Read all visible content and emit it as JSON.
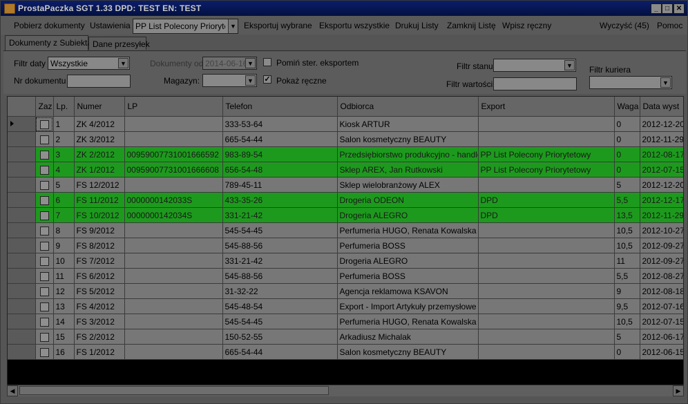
{
  "window": {
    "title": "ProstaPaczka SGT 1.33 DPD: TEST EN: TEST",
    "minimize": "_",
    "maximize": "□",
    "close": "✕"
  },
  "menu": {
    "fetch": "Pobierz dokumenty",
    "settings": "Ustawienia",
    "print_type": "PP List Polecony Priorytetowy",
    "export_selected": "Eksportuj wybrane",
    "export_all": "Eksportu wszystkie",
    "print_labels": "Drukuj Listy",
    "close_list": "Zamknij Listę",
    "manual_entry": "Wpisz ręczny",
    "clear": "Wyczyść (45)",
    "help": "Pomoc"
  },
  "tabs": [
    "Dokumenty z Subiekta",
    "Dane przesyłek"
  ],
  "filters": {
    "date_filter_label": "Filtr daty",
    "date_filter_value": "Wszystkie",
    "doc_number_label": "Nr dokumentu",
    "docs_from_label": "Dokumenty od:",
    "docs_from_value": "2014-06-16",
    "warehouse_label": "Magazyn:",
    "skip_exported_label": "Pomiń ster. eksportem",
    "show_manual_label": "Pokaż ręczne",
    "show_manual_checked": true,
    "skip_exported_checked": false,
    "status_filter_label": "Filtr stanu",
    "value_filter_label": "Filtr wartości",
    "courier_filter_label": "Filtr kuriera"
  },
  "grid": {
    "columns": [
      "",
      "Zaz",
      "Lp.",
      "Numer",
      "LP",
      "Telefon",
      "Odbiorca",
      "Export",
      "Waga",
      "Data wyst"
    ],
    "rows": [
      {
        "lp": "1",
        "numer": "ZK 4/2012",
        "lpnum": "",
        "telefon": "333-53-64",
        "odbiorca": "Kiosk ARTUR",
        "export": "",
        "waga": "0",
        "data": "2012-12-20",
        "green": false
      },
      {
        "lp": "2",
        "numer": "ZK 3/2012",
        "lpnum": "",
        "telefon": "665-54-44",
        "odbiorca": "Salon kosmetyczny BEAUTY",
        "export": "",
        "waga": "0",
        "data": "2012-11-29",
        "green": false
      },
      {
        "lp": "3",
        "numer": "ZK 2/2012",
        "lpnum": "00959007731001666592",
        "telefon": "983-89-54",
        "odbiorca": "Przedsiębiorstwo produkcyjno - handlo...",
        "export": "PP List Polecony Priorytetowy",
        "waga": "0",
        "data": "2012-08-17",
        "green": true
      },
      {
        "lp": "4",
        "numer": "ZK 1/2012",
        "lpnum": "00959007731001666608",
        "telefon": "656-54-48",
        "odbiorca": "Sklep AREX, Jan Rutkowski",
        "export": "PP List Polecony Priorytetowy",
        "waga": "0",
        "data": "2012-07-15",
        "green": true
      },
      {
        "lp": "5",
        "numer": "FS 12/2012",
        "lpnum": "",
        "telefon": "789-45-11",
        "odbiorca": "Sklep wielobranżowy ALEX",
        "export": "",
        "waga": "5",
        "data": "2012-12-20",
        "green": false
      },
      {
        "lp": "6",
        "numer": "FS 11/2012",
        "lpnum": "0000000142033S",
        "telefon": "433-35-26",
        "odbiorca": "Drogeria ODEON",
        "export": "DPD",
        "waga": "5,5",
        "data": "2012-12-17",
        "green": true
      },
      {
        "lp": "7",
        "numer": "FS 10/2012",
        "lpnum": "0000000142034S",
        "telefon": "331-21-42",
        "odbiorca": "Drogeria ALEGRO",
        "export": "DPD",
        "waga": "13,5",
        "data": "2012-11-29",
        "green": true
      },
      {
        "lp": "8",
        "numer": "FS 9/2012",
        "lpnum": "",
        "telefon": "545-54-45",
        "odbiorca": "Perfumeria HUGO, Renata Kowalska",
        "export": "",
        "waga": "10,5",
        "data": "2012-10-27",
        "green": false
      },
      {
        "lp": "9",
        "numer": "FS 8/2012",
        "lpnum": "",
        "telefon": "545-88-56",
        "odbiorca": "Perfumeria BOSS",
        "export": "",
        "waga": "10,5",
        "data": "2012-09-27",
        "green": false
      },
      {
        "lp": "10",
        "numer": "FS 7/2012",
        "lpnum": "",
        "telefon": "331-21-42",
        "odbiorca": "Drogeria ALEGRO",
        "export": "",
        "waga": "11",
        "data": "2012-09-27",
        "green": false
      },
      {
        "lp": "11",
        "numer": "FS 6/2012",
        "lpnum": "",
        "telefon": "545-88-56",
        "odbiorca": "Perfumeria BOSS",
        "export": "",
        "waga": "5,5",
        "data": "2012-08-27",
        "green": false
      },
      {
        "lp": "12",
        "numer": "FS 5/2012",
        "lpnum": "",
        "telefon": "31-32-22",
        "odbiorca": "Agencja reklamowa KSAVON",
        "export": "",
        "waga": "9",
        "data": "2012-08-18",
        "green": false
      },
      {
        "lp": "13",
        "numer": "FS 4/2012",
        "lpnum": "",
        "telefon": "545-48-54",
        "odbiorca": "Export - Import Artykuły przemysłowe",
        "export": "",
        "waga": "9,5",
        "data": "2012-07-16",
        "green": false
      },
      {
        "lp": "14",
        "numer": "FS 3/2012",
        "lpnum": "",
        "telefon": "545-54-45",
        "odbiorca": "Perfumeria HUGO, Renata Kowalska",
        "export": "",
        "waga": "10,5",
        "data": "2012-07-15",
        "green": false
      },
      {
        "lp": "15",
        "numer": "FS 2/2012",
        "lpnum": "",
        "telefon": "150-52-55",
        "odbiorca": "Arkadiusz Michalak",
        "export": "",
        "waga": "5",
        "data": "2012-06-17",
        "green": false
      },
      {
        "lp": "16",
        "numer": "FS 1/2012",
        "lpnum": "",
        "telefon": "665-54-44",
        "odbiorca": "Salon kosmetyczny BEAUTY",
        "export": "",
        "waga": "0",
        "data": "2012-06-15",
        "green": false
      }
    ]
  },
  "colors": {
    "exported_row": "#1d9a1d",
    "title_bar": "#0b1d6b"
  }
}
